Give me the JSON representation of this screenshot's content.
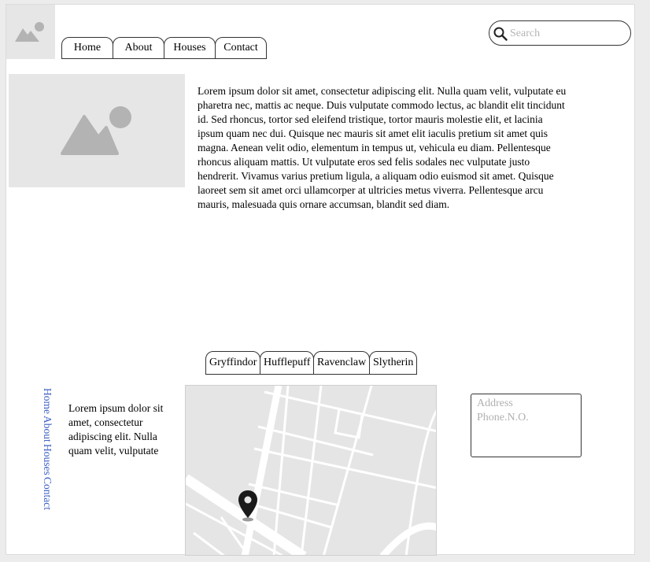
{
  "header": {
    "logo_icon": "image-placeholder-icon",
    "nav": [
      "Home",
      "About",
      "Houses",
      "Contact"
    ],
    "search": {
      "placeholder": "Search",
      "value": ""
    }
  },
  "hero": {
    "image_icon": "image-placeholder-icon",
    "text": "Lorem ipsum dolor sit amet, consectetur adipiscing elit. Nulla quam velit, vulputate eu pharetra nec, mattis ac neque. Duis vulputate commodo lectus, ac blandit elit tincidunt id. Sed rhoncus, tortor sed eleifend tristique, tortor mauris molestie elit, et lacinia ipsum quam nec dui. Quisque nec mauris sit amet elit iaculis pretium sit amet quis magna. Aenean velit odio, elementum in tempus ut, vehicula eu diam. Pellentesque rhoncus aliquam mattis. Ut vulputate eros sed felis sodales nec vulputate justo hendrerit. Vivamus varius pretium ligula, a aliquam odio euismod sit amet. Quisque laoreet sem sit amet orci ullamcorper at ultricies metus viverra. Pellentesque arcu mauris, malesuada quis ornare accumsan, blandit sed diam."
  },
  "houses": [
    "Gryffindor",
    "Hufflepuff",
    "Ravenclaw",
    "Slytherin"
  ],
  "footer": {
    "nav": [
      "Home",
      "About",
      "Houses",
      "Contact"
    ],
    "text": "Lorem ipsum dolor sit amet, consectetur adipiscing elit. Nulla quam velit, vulputate",
    "map_icon": "map-pin-icon",
    "contact": {
      "address": "Address",
      "phone": "Phone.N.O."
    }
  },
  "colors": {
    "placeholder_bg": "#e6e6e6",
    "link": "#3b5fc4",
    "map_bg": "#e5e5e5"
  }
}
